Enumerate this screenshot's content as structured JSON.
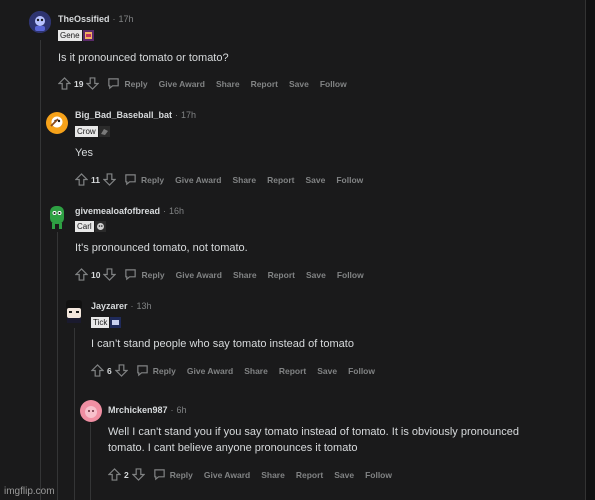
{
  "comments": [
    {
      "user": "TheOssified",
      "time": "17h",
      "flair": "Gene",
      "body": "Is it pronounced tomato or tomato?",
      "votes": "19",
      "avatar_color": "#4c5ff0"
    },
    {
      "user": "Big_Bad_Baseball_bat",
      "time": "17h",
      "flair": "Crow",
      "body": "Yes",
      "votes": "11",
      "avatar_color": "#f6a21a"
    },
    {
      "user": "givemealoafofbread",
      "time": "16h",
      "flair": "Carl",
      "body": "It's pronounced tomato, not tomato.",
      "votes": "10",
      "avatar_color": "#2ea043"
    },
    {
      "user": "Jayzarer",
      "time": "13h",
      "flair": "Tick",
      "body": "I can’t stand people who say tomato instead of tomato",
      "votes": "6",
      "avatar_color": "#2a2a2e"
    },
    {
      "user": "Mrchicken987",
      "time": "6h",
      "body_line1": "Well I can't stand you if you say tomato instead of tomato. It is obviously pronounced",
      "body_line2": "tomato. I cant believe anyone pronounces it tomato",
      "votes": "2",
      "avatar_color": "#f08fa3"
    }
  ],
  "actions": {
    "reply": "Reply",
    "give_award": "Give Award",
    "share": "Share",
    "report": "Report",
    "save": "Save",
    "follow": "Follow"
  },
  "separator": "·",
  "watermark": "imgflip.com"
}
